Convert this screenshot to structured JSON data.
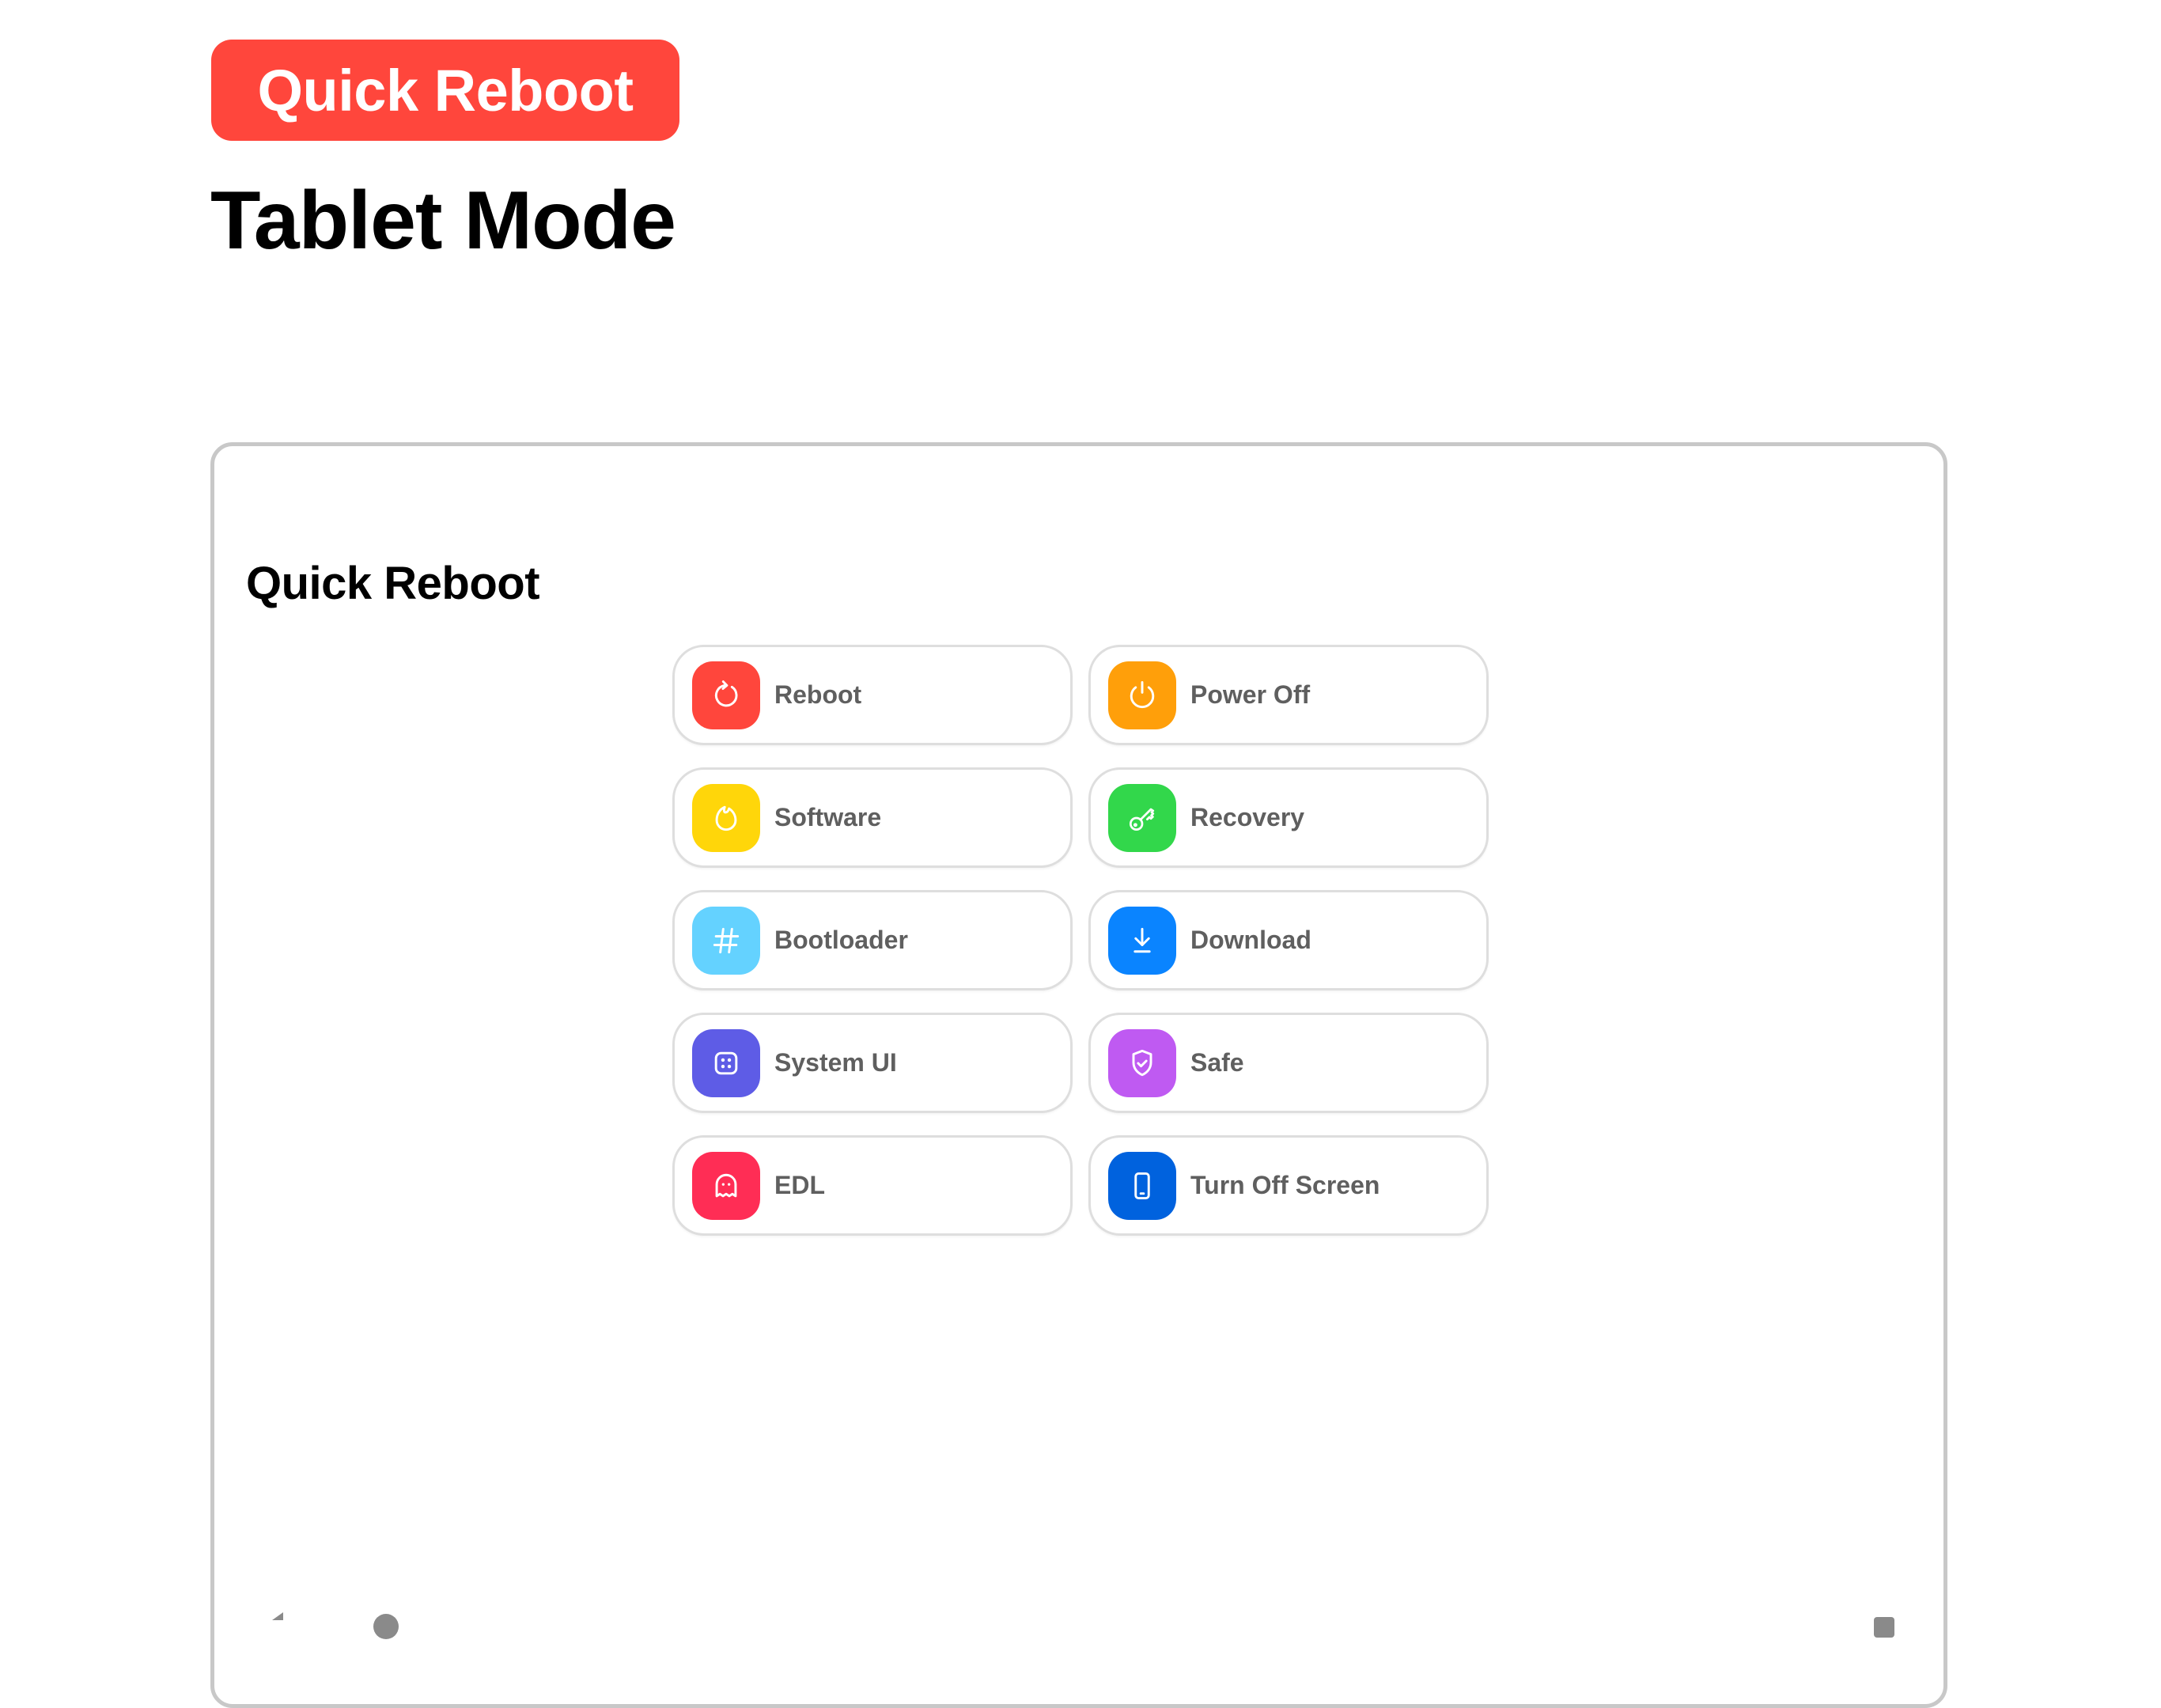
{
  "header": {
    "badge_label": "Quick Reboot",
    "page_title": "Tablet Mode"
  },
  "panel": {
    "title": "Quick Reboot",
    "actions": [
      {
        "label": "Reboot",
        "icon": "refresh-icon",
        "color": "#ff463c"
      },
      {
        "label": "Power Off",
        "icon": "power-icon",
        "color": "#ff9f0a"
      },
      {
        "label": "Software",
        "icon": "flame-icon",
        "color": "#ffd60a"
      },
      {
        "label": "Recovery",
        "icon": "key-icon",
        "color": "#32d74b"
      },
      {
        "label": "Bootloader",
        "icon": "hash-icon",
        "color": "#64d2ff"
      },
      {
        "label": "Download",
        "icon": "download-icon",
        "color": "#0a84ff"
      },
      {
        "label": "System UI",
        "icon": "dice-icon",
        "color": "#5e5ce6"
      },
      {
        "label": "Safe",
        "icon": "shield-check-icon",
        "color": "#bf5af2"
      },
      {
        "label": "EDL",
        "icon": "ghost-icon",
        "color": "#ff2d55"
      },
      {
        "label": "Turn Off Screen",
        "icon": "phone-icon",
        "color": "#0062de"
      }
    ]
  },
  "navbar": {
    "items": [
      "back-icon",
      "home-icon",
      "recents-icon"
    ]
  },
  "colors": {
    "accent": "#ff463c",
    "panel_border": "#c8c8c8",
    "label_text": "#5f5f5f"
  }
}
